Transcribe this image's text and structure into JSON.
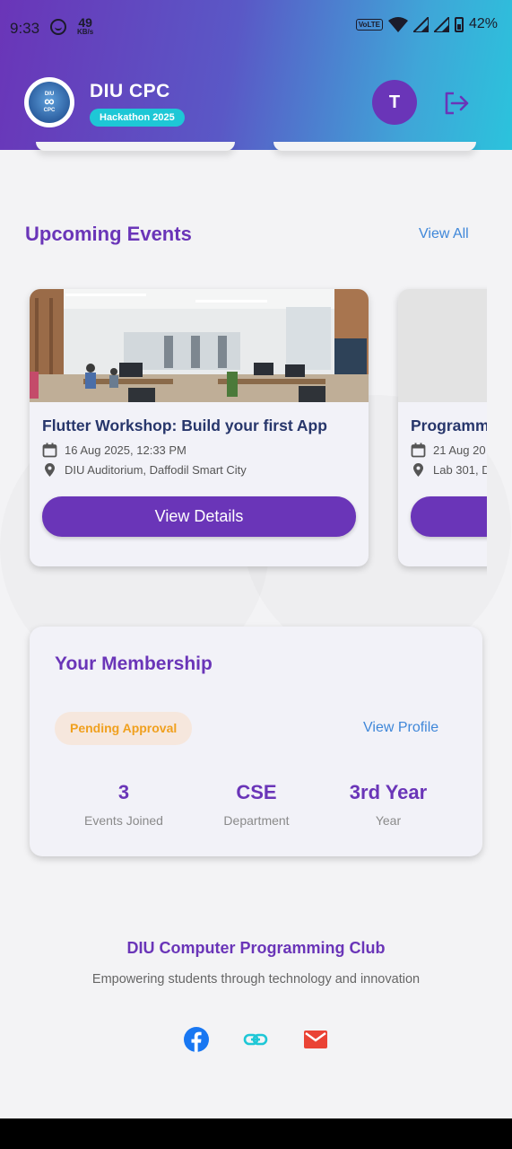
{
  "status_bar": {
    "time": "9:33",
    "net_speed": "49",
    "net_unit": "KB/s",
    "volte": "VoLTE",
    "battery": "42%"
  },
  "header": {
    "logo_text_top": "DIU",
    "logo_text_bottom": "CPC",
    "app_title": "DIU CPC",
    "chip_label": "Hackathon 2025",
    "avatar_initial": "T",
    "logout_icon": "logout-icon",
    "gradient_start": "#6a35b8",
    "gradient_end": "#2bc3dc"
  },
  "upcoming": {
    "title": "Upcoming Events",
    "view_all": "View All",
    "events": [
      {
        "title": "Flutter Workshop: Build your first App",
        "date": "16 Aug 2025, 12:33 PM",
        "location": "DIU Auditorium, Daffodil Smart City",
        "button": "View Details"
      },
      {
        "title": "Programm",
        "date": "21 Aug 20",
        "location": "Lab 301, D",
        "button": ""
      }
    ]
  },
  "membership": {
    "title": "Your Membership",
    "status": "Pending Approval",
    "view_profile": "View Profile",
    "stats": [
      {
        "value": "3",
        "label": "Events Joined"
      },
      {
        "value": "CSE",
        "label": "Department"
      },
      {
        "value": "3rd Year",
        "label": "Year"
      }
    ]
  },
  "footer": {
    "title": "DIU Computer Programming Club",
    "subtitle": "Empowering students through technology and innovation",
    "icons": [
      "facebook-icon",
      "link-icon",
      "email-icon"
    ]
  },
  "colors": {
    "primary": "#6a35b8",
    "link": "#3f87d9",
    "accent": "#1ec7d6",
    "pending": "#f0a01e"
  }
}
